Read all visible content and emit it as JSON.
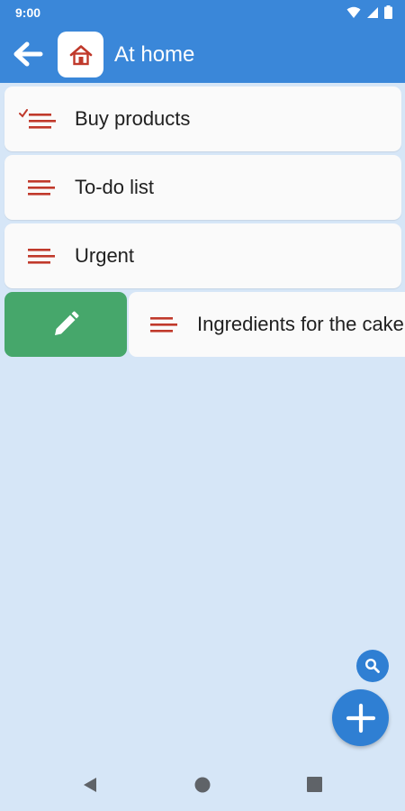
{
  "status_bar": {
    "time": "9:00"
  },
  "app_bar": {
    "title": "At home"
  },
  "lists": [
    {
      "label": "Buy products",
      "icon": "checked-list-icon"
    },
    {
      "label": "To-do list",
      "icon": "list-lines-icon"
    },
    {
      "label": "Urgent",
      "icon": "list-lines-icon"
    }
  ],
  "swiped_item": {
    "label": "Ingredients for the cake",
    "action": "edit"
  },
  "colors": {
    "accent": "#3a87d9",
    "icon_red": "#c0392b",
    "edit_green": "#46a76b",
    "background": "#d6e6f7",
    "fab": "#2f7fd3"
  }
}
